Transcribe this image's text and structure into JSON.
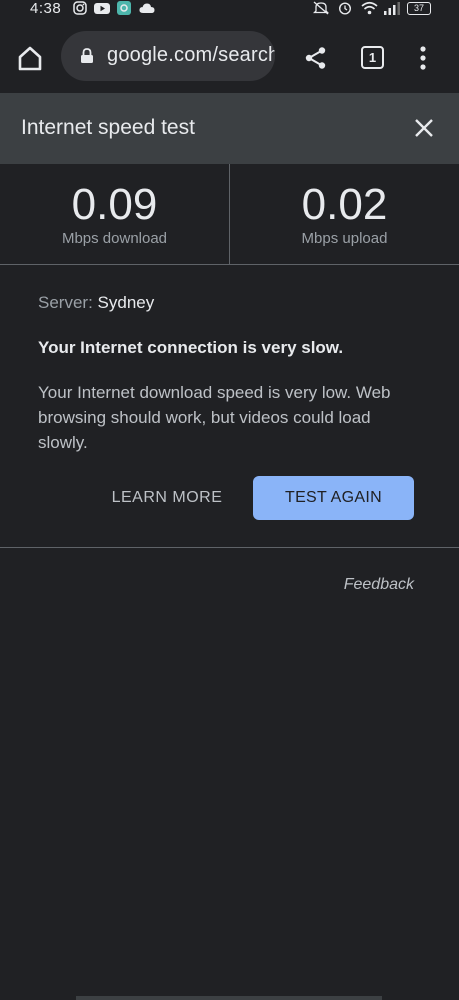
{
  "status_bar": {
    "time": "4:38",
    "battery": "37",
    "icons": [
      "instagram-icon",
      "youtube-icon",
      "app-icon",
      "cloud-icon",
      "mute-icon",
      "alarm-icon",
      "wifi-icon",
      "signal-icon",
      "battery-icon"
    ]
  },
  "browser": {
    "url": "google.com/search",
    "tab_count": "1",
    "icons": [
      "home-icon",
      "lock-icon",
      "share-icon",
      "tabs-icon",
      "more-vert-icon"
    ]
  },
  "speed_test": {
    "title": "Internet speed test",
    "download": {
      "value": "0.09",
      "unit": "Mbps download"
    },
    "upload": {
      "value": "0.02",
      "unit": "Mbps upload"
    },
    "server_label": "Server:",
    "server_value": "Sydney",
    "verdict": "Your Internet connection is very slow.",
    "description": "Your Internet download speed is very low. Web browsing should work, but videos could load slowly.",
    "learn_more": "LEARN MORE",
    "test_again": "TEST AGAIN",
    "feedback": "Feedback"
  },
  "colors": {
    "background": "#202124",
    "header": "#3c4043",
    "accent": "#8ab4f8"
  }
}
